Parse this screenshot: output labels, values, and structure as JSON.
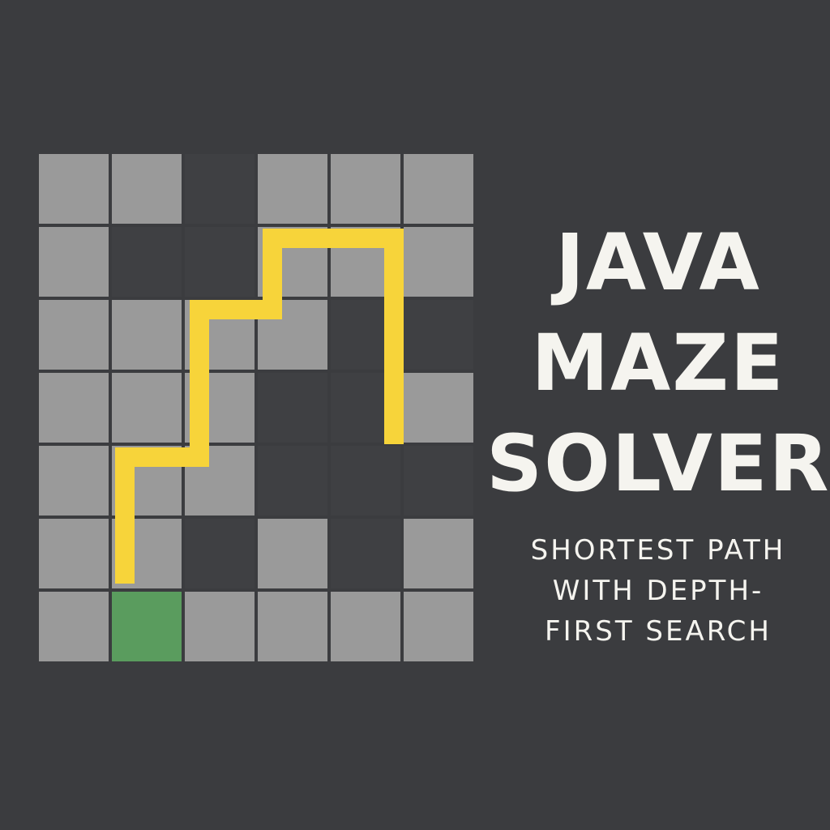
{
  "title": {
    "lines": [
      "JAVA",
      "MAZE",
      "SOLVER"
    ]
  },
  "subtitle": {
    "lines": [
      "SHORTEST PATH",
      "WITH DEPTH-",
      "FIRST SEARCH"
    ]
  },
  "maze": {
    "rows": 7,
    "cols": 6,
    "grid": [
      [
        "open",
        "open",
        "wall",
        "open",
        "open",
        "open"
      ],
      [
        "open",
        "wall",
        "wall",
        "open",
        "open",
        "open"
      ],
      [
        "open",
        "open",
        "open",
        "open",
        "wall",
        "wall"
      ],
      [
        "open",
        "open",
        "open",
        "wall",
        "wall",
        "open"
      ],
      [
        "open",
        "open",
        "open",
        "wall",
        "wall",
        "wall"
      ],
      [
        "open",
        "open",
        "wall",
        "open",
        "wall",
        "open"
      ],
      [
        "open",
        "goal",
        "open",
        "open",
        "open",
        "open"
      ]
    ],
    "path": [
      [
        1,
        6
      ],
      [
        1,
        4
      ],
      [
        2,
        4
      ],
      [
        2,
        2
      ],
      [
        3,
        2
      ],
      [
        3,
        1
      ],
      [
        4,
        1
      ],
      [
        4,
        4
      ]
    ],
    "colors": {
      "background": "#3b3c3f",
      "open": "#9a9a9a",
      "wall": "#3f4043",
      "goal": "#5a9c5e",
      "path": "#f7d43a",
      "text": "#f5f4ef"
    }
  }
}
